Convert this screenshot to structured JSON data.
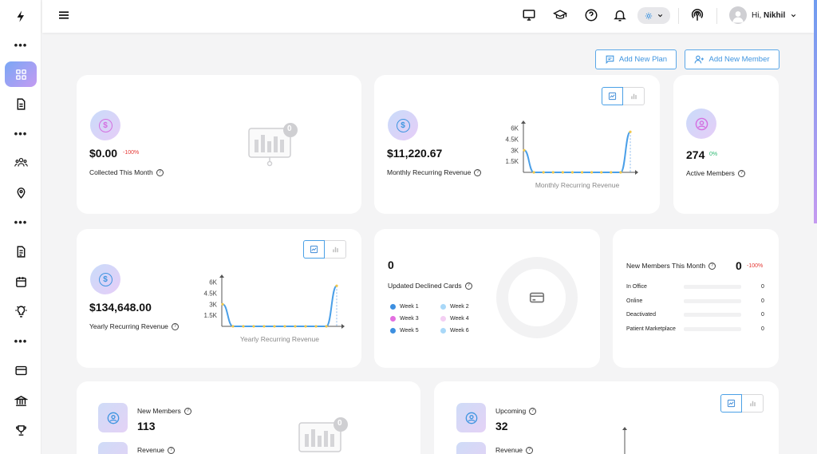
{
  "user": {
    "greeting": "Hi, ",
    "name": "Nikhil"
  },
  "actions": {
    "add_plan": "Add New Plan",
    "add_member": "Add New Member"
  },
  "cards": {
    "collected": {
      "value": "$0.00",
      "change": "-100%",
      "label": "Collected This Month",
      "empty_count": "0"
    },
    "monthly": {
      "value": "$11,220.67",
      "label": "Monthly Recurring Revenue"
    },
    "active": {
      "value": "274",
      "change": "0%",
      "label": "Active Members"
    },
    "yearly": {
      "value": "$134,648.00",
      "label": "Yearly Recurring Revenue"
    },
    "declined": {
      "value": "0",
      "label": "Updated Declined Cards",
      "weeks": [
        {
          "label": "Week 1",
          "color": "#3d8fe0"
        },
        {
          "label": "Week 2",
          "color": "#a9d8f8"
        },
        {
          "label": "Week 3",
          "color": "#e36fe0"
        },
        {
          "label": "Week 4",
          "color": "#f4cff3"
        },
        {
          "label": "Week 5",
          "color": "#3d8fe0"
        },
        {
          "label": "Week 6",
          "color": "#a9d8f8"
        }
      ]
    },
    "new_members": {
      "title": "New Members This Month",
      "value": "0",
      "change": "-100%",
      "rows": [
        {
          "label": "In Office",
          "value": "0"
        },
        {
          "label": "Online",
          "value": "0"
        },
        {
          "label": "Deactivated",
          "value": "0"
        },
        {
          "label": "Patient Marketplace",
          "value": "0"
        }
      ]
    },
    "bottom_left": {
      "new_members_label": "New Members",
      "new_members_value": "113",
      "revenue_label": "Revenue",
      "empty_count": "0"
    },
    "bottom_right": {
      "upcoming_label": "Upcoming",
      "upcoming_value": "32",
      "revenue_label": "Revenue"
    }
  },
  "chart_data": [
    {
      "type": "line",
      "title": "",
      "xlabel": "Monthly Recurring Revenue",
      "ylabel": "",
      "yticks": [
        "1.5K",
        "3K",
        "4.5K",
        "6K"
      ],
      "ylim": [
        0,
        6500
      ],
      "series": [
        {
          "values": [
            3000,
            0,
            0,
            0,
            0,
            0,
            0,
            0,
            0,
            0,
            0,
            5500
          ]
        }
      ]
    },
    {
      "type": "line",
      "title": "",
      "xlabel": "Yearly Recurring Revenue",
      "ylabel": "",
      "yticks": [
        "1.5K",
        "3K",
        "4.5K",
        "6K"
      ],
      "ylim": [
        0,
        6500
      ],
      "series": [
        {
          "values": [
            3000,
            0,
            0,
            0,
            0,
            0,
            0,
            0,
            0,
            0,
            0,
            5500
          ]
        }
      ]
    }
  ],
  "colors": {
    "accent": "#3f95e0",
    "negative": "#e53935",
    "positive": "#2eb872",
    "line": "#4a9fe8",
    "marker": "#f2c94c"
  }
}
